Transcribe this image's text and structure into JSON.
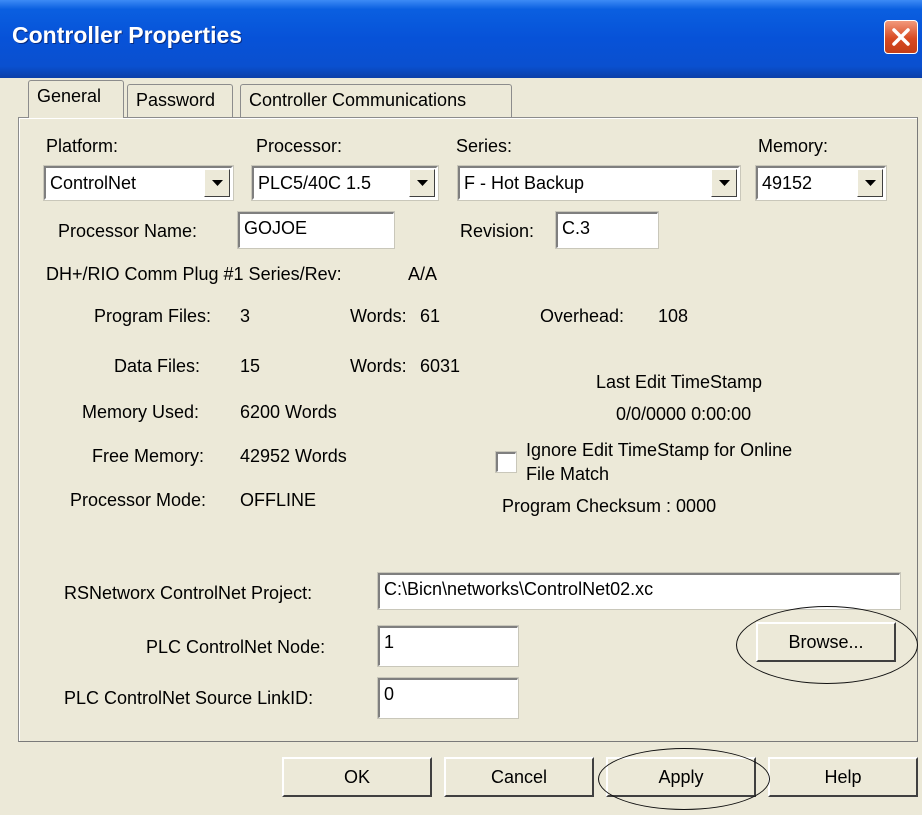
{
  "window": {
    "title": "Controller Properties"
  },
  "tabs": [
    {
      "label": "General"
    },
    {
      "label": "Password"
    },
    {
      "label": "Controller Communications"
    }
  ],
  "platform": {
    "label": "Platform:",
    "value": "ControlNet"
  },
  "processor": {
    "label": "Processor:",
    "value": "PLC5/40C 1.5"
  },
  "series": {
    "label": "Series:",
    "value": "F - Hot Backup"
  },
  "memory": {
    "label": "Memory:",
    "value": "49152"
  },
  "processor_name": {
    "label": "Processor Name:",
    "value": "GOJOE"
  },
  "revision": {
    "label": "Revision:",
    "value": "C.3"
  },
  "dh_rio": {
    "label": "DH+/RIO Comm Plug #1 Series/Rev:",
    "value": "A/A"
  },
  "stats": {
    "program_files_label": "Program Files:",
    "program_files": "3",
    "program_words_label": "Words:",
    "program_words": "61",
    "overhead_label": "Overhead:",
    "overhead": "108",
    "data_files_label": "Data Files:",
    "data_files": "15",
    "data_words_label": "Words:",
    "data_words": "6031",
    "memory_used_label": "Memory Used:",
    "memory_used": "6200 Words",
    "free_memory_label": "Free Memory:",
    "free_memory": "42952 Words",
    "processor_mode_label": "Processor Mode:",
    "processor_mode": "OFFLINE"
  },
  "timestamp": {
    "label": "Last Edit TimeStamp",
    "value": "0/0/0000  0:00:00",
    "ignore_line1": "Ignore Edit TimeStamp for Online",
    "ignore_line2": "File Match",
    "checksum": "Program Checksum : 0000"
  },
  "controlnet": {
    "project_label": "RSNetworx ControlNet Project:",
    "project_value": "C:\\Bicn\\networks\\ControlNet02.xc",
    "browse_label": "Browse...",
    "node_label": "PLC ControlNet Node:",
    "node_value": "1",
    "linkid_label": "PLC ControlNet Source LinkID:",
    "linkid_value": "0"
  },
  "buttons": {
    "ok": "OK",
    "cancel": "Cancel",
    "apply": "Apply",
    "help": "Help"
  }
}
